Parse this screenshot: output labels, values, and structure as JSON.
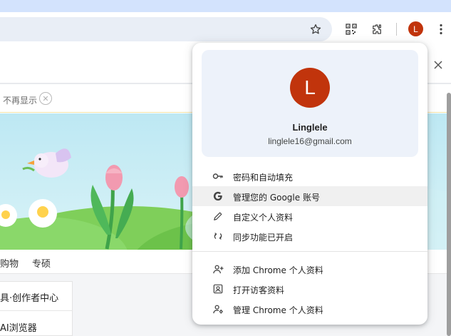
{
  "browser": {
    "avatar_letter": "L",
    "accent": "#c1340c",
    "toolbar_icons": [
      "star-icon",
      "qr-code-icon",
      "extensions-icon",
      "more-menu-icon"
    ]
  },
  "page": {
    "notice_text": "不再显示",
    "nav_items": [
      "购物",
      "专硕"
    ],
    "card_items": [
      "具·创作者中心",
      "AI浏览器"
    ]
  },
  "profile_menu": {
    "avatar_letter": "L",
    "name": "Linglele",
    "email": "linglele16@gmail.com",
    "items": [
      {
        "icon": "key-icon",
        "label": "密码和自动填充"
      },
      {
        "icon": "google-g-icon",
        "label": "管理您的 Google 账号"
      },
      {
        "icon": "pencil-icon",
        "label": "自定义个人资料"
      },
      {
        "icon": "sync-icon",
        "label": "同步功能已开启"
      },
      {
        "icon": "add-person-icon",
        "label": "添加 Chrome 个人资料"
      },
      {
        "icon": "guest-profile-icon",
        "label": "打开访客资料"
      },
      {
        "icon": "manage-profiles-icon",
        "label": "管理 Chrome 个人资料"
      }
    ]
  }
}
